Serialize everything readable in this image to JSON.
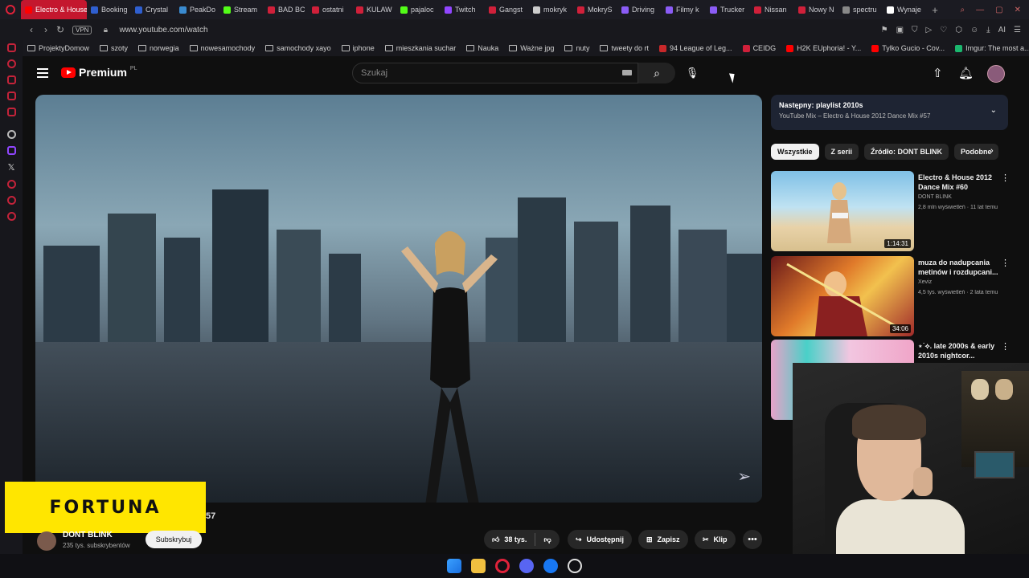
{
  "browser": {
    "tabs": [
      {
        "label": "Electro & House",
        "color": "#ff0000",
        "active": true
      },
      {
        "label": "Booking",
        "color": "#2f5fd0"
      },
      {
        "label": "Crystal",
        "color": "#2f5fd0"
      },
      {
        "label": "PeakDo",
        "color": "#3a8bd0"
      },
      {
        "label": "Stream",
        "color": "#53fc18"
      },
      {
        "label": "BAD BC",
        "color": "#d0203a"
      },
      {
        "label": "ostatni",
        "color": "#d0203a"
      },
      {
        "label": "KULAW",
        "color": "#d0203a"
      },
      {
        "label": "pajaloc",
        "color": "#53fc18"
      },
      {
        "label": "Twitch",
        "color": "#9146ff"
      },
      {
        "label": "Gangst",
        "color": "#d0203a"
      },
      {
        "label": "mokryk",
        "color": "#cccccc"
      },
      {
        "label": "MokryS",
        "color": "#d0203a"
      },
      {
        "label": "Driving",
        "color": "#8b5cf6"
      },
      {
        "label": "Filmy k",
        "color": "#8b5cf6"
      },
      {
        "label": "Trucker",
        "color": "#8b5cf6"
      },
      {
        "label": "Nissan",
        "color": "#d0203a"
      },
      {
        "label": "Nowy N",
        "color": "#d0203a"
      },
      {
        "label": "spectru",
        "color": "#888888"
      },
      {
        "label": "Wynaje",
        "color": "#ffffff"
      }
    ],
    "new_tab": "+",
    "url": "www.youtube.com/watch",
    "vpn": "VPN",
    "ai_label": "AI",
    "bookmarks": [
      {
        "label": "ProjektyDomow",
        "icon": "folder"
      },
      {
        "label": "szoty",
        "icon": "folder"
      },
      {
        "label": "norwegia",
        "icon": "folder"
      },
      {
        "label": "nowesamochody",
        "icon": "folder"
      },
      {
        "label": "samochody xayo",
        "icon": "folder"
      },
      {
        "label": "iphone",
        "icon": "folder"
      },
      {
        "label": "mieszkania suchar",
        "icon": "folder"
      },
      {
        "label": "Nauka",
        "icon": "folder"
      },
      {
        "label": "Ważne jpg",
        "icon": "folder"
      },
      {
        "label": "nuty",
        "icon": "folder"
      },
      {
        "label": "tweety do rt",
        "icon": "folder"
      },
      {
        "label": "94 League of Leg...",
        "icon": "lol"
      },
      {
        "label": "CEIDG",
        "icon": "ceidg"
      },
      {
        "label": "H2K EUphoria! - Y...",
        "icon": "youtube"
      },
      {
        "label": "Tylko Gucio - Cov...",
        "icon": "youtube"
      },
      {
        "label": "Imgur: The most a...",
        "icon": "imgur"
      }
    ]
  },
  "youtube": {
    "logo_text": "Premium",
    "logo_region": "PL",
    "search_placeholder": "Szukaj",
    "video_title_fragment": "57",
    "channel_name": "DONT BLINK",
    "subscribers": "235 tys. subskrybentów",
    "subscribe_label": "Subskrybuj",
    "likes": "38 tys.",
    "share_label": "Udostępnij",
    "save_label": "Zapisz",
    "clip_label": "Klip",
    "overlay_brand": "FORTUNA",
    "up_next": {
      "label": "Następny: playlist 2010s",
      "subtitle": "YouTube Mix – Electro & House 2012 Dance Mix #57"
    },
    "chips": [
      "Wszystkie",
      "Z serii",
      "Źródło: DONT BLINK",
      "Podobne"
    ],
    "recommendations": [
      {
        "title": "Electro & House 2012 Dance Mix #60",
        "channel": "DONT BLINK",
        "meta": "2,8 mln wyświetleń · 11 lat temu",
        "duration": "1:14:31"
      },
      {
        "title": "muza do nadupcania metinów i rozdupcani...",
        "channel": "Xeviz",
        "meta": "4,5 tys. wyświetleń · 2 lata temu",
        "duration": "34:06"
      },
      {
        "title": "⋆˙⟡. late 2000s & early 2010s nightcor...",
        "channel": "",
        "meta": "",
        "duration": ""
      }
    ]
  },
  "colors": {
    "accent": "#ff0000",
    "opera": "#e0223a",
    "fortuna": "#ffe600"
  }
}
